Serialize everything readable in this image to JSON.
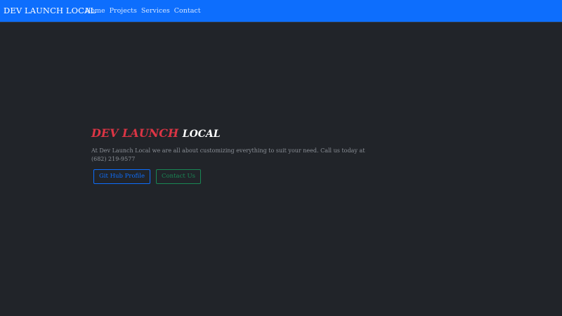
{
  "navbar": {
    "brand": "DEV LAUNCH LOCAL",
    "links": [
      "Home",
      "Projects",
      "Services",
      "Contact"
    ]
  },
  "hero": {
    "title_accent": "DEV LAUNCH",
    "title_rest": "LOCAL",
    "description": "At Dev Launch Local we are all about customizing everything to suit your need. Call us today at (682) 219-9577",
    "buttons": {
      "github_label": "Git Hub Profile",
      "contact_label": "Contact Us"
    }
  },
  "colors": {
    "navbar_bg": "#0d6efd",
    "page_bg": "#212429",
    "accent_red": "#dc3545",
    "primary_blue": "#0d6efd",
    "success_green": "#198754"
  }
}
